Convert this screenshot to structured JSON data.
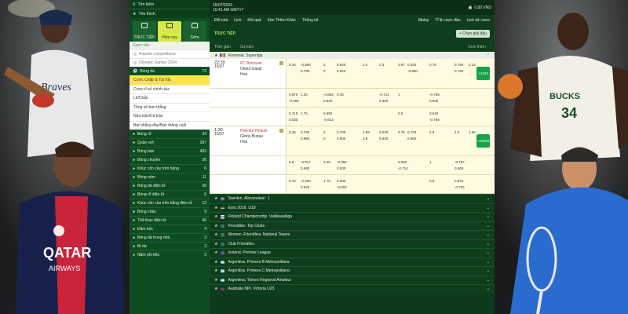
{
  "sidebar": {
    "search_label": "Tìm kiếm",
    "favorites_label": "Yêu thích",
    "tabs": [
      {
        "label": "TRỰC TIẾP",
        "active": false
      },
      {
        "label": "Hôm nay",
        "active": true
      },
      {
        "label": "Sớm",
        "active": false
      }
    ],
    "section_title": "Gạch sẵn",
    "suggestions": [
      "Popular competitions",
      "Olympic Games 2024"
    ],
    "football": {
      "label": "Bóng đá",
      "count": "72"
    },
    "bet_types": [
      "Cược Chấp & Tài Xỉu",
      "Cược tỉ số chính xác",
      "Lẻ/Chẵn",
      "Tổng số bàn thắng",
      "Nửa trận/Cả trận",
      "Bàn thắng đầu/Bàn thắng cuối"
    ],
    "sports": [
      {
        "label": "Bóng rổ",
        "count": "24"
      },
      {
        "label": "Quần vợt",
        "count": "287"
      },
      {
        "label": "Bóng bàn",
        "count": "409"
      },
      {
        "label": "Bóng chuyền",
        "count": "36"
      },
      {
        "label": "Khúc côn cầu trên băng",
        "count": "6"
      },
      {
        "label": "Bóng ném",
        "count": "11"
      },
      {
        "label": "Bóng đá điện tử",
        "count": "58"
      },
      {
        "label": "Bóng rổ điện tử",
        "count": "6"
      },
      {
        "label": "Khúc côn cầu trên băng điện tử",
        "count": "12"
      },
      {
        "label": "Bóng chày",
        "count": "9"
      },
      {
        "label": "Thể thao điện tử",
        "count": "46"
      },
      {
        "label": "Đấm bốc",
        "count": "4"
      },
      {
        "label": "Bóng đá trong nhà",
        "count": "3"
      },
      {
        "label": "Bi-da",
        "count": "3"
      },
      {
        "label": "Năm phi tiêu",
        "count": "3"
      }
    ]
  },
  "topbar": {
    "date": "15/07/2024",
    "time": "10:41 AM GMT+7",
    "balance": "0.00 VND"
  },
  "nav": {
    "items": [
      "Đổi nhà",
      "Lịch",
      "Kết quả",
      "Kèo Thêm Khảo",
      "Thống kê"
    ],
    "right": [
      "Malay",
      "Tỉ lệ cược đầu",
      "Lịch sử cược"
    ]
  },
  "section": {
    "live_label": "TRỰC TIẾP",
    "button_label": "Chọn giải đấu"
  },
  "columns": {
    "time": "Thời gian",
    "event": "Sự kiện",
    "more": "Xem thêm"
  },
  "league_main": "Romania. Superliga",
  "matches": [
    {
      "time": "22:30",
      "date": "15/07",
      "home": "FC Botosani",
      "away": "Otelul Galati",
      "draw": "Hoà",
      "more": "+1103",
      "rows": [
        [
          "0.25",
          "-0.990",
          "2",
          "0.830",
          "2.4",
          "2.3",
          "2.87",
          "0.630",
          "0.75",
          "0.780",
          "2.15",
          "4.1",
          "1.90"
        ],
        [
          "",
          "0.790",
          "0",
          "0.820",
          "",
          "",
          "",
          "-0.980",
          "",
          "0.790",
          "",
          "",
          ""
        ]
      ],
      "extra": [
        [
          "0.670",
          "1.25",
          "-0.862",
          "0.25",
          "-0.714",
          "1",
          "-0.769"
        ],
        [
          "-0.909",
          "",
          "0.620",
          "",
          "0.500",
          "",
          "0.500"
        ],
        [
          "0.718",
          "1.75",
          "0.650",
          "",
          "",
          "0.5",
          "0.540"
        ],
        [
          "0.530",
          "",
          "-0.813",
          "",
          "",
          "",
          "-0.758"
        ]
      ]
    },
    {
      "time": "1:30",
      "date": "16/07",
      "home": "Petrolul Ploiesti",
      "away": "Gloria Buzau",
      "draw": "Hoà",
      "more": "+10293",
      "rows": [
        [
          "0.25",
          "0.750",
          "2",
          "0.790",
          "2.09",
          "0.630",
          "0.75",
          "0.720",
          "2.8",
          "4.0",
          "1.95"
        ],
        [
          "",
          "0.980",
          "0",
          "0.950",
          "3.8",
          "0.630",
          "",
          "0.960",
          "",
          "",
          ""
        ]
      ],
      "extra": [
        [
          "0.5",
          "-0.917",
          "2.25",
          "-0.050",
          "",
          "0.500",
          "1",
          "-0.787"
        ],
        [
          "",
          "0.690",
          "",
          "0.630",
          "",
          "-0.714",
          "",
          "0.500"
        ],
        [
          "0.75",
          "-0.800",
          "1.75",
          "0.590",
          "",
          "",
          "0.5",
          "0.510"
        ],
        [
          "",
          "0.520",
          "",
          "-0.800",
          "",
          "",
          "",
          "-0.725"
        ]
      ]
    }
  ],
  "leagues": [
    {
      "name": "Sweden. Allsvenskan",
      "count": "1",
      "colors": [
        "#2a5db0",
        "#f4c430"
      ]
    },
    {
      "name": "Euro 2016. U19",
      "count": "",
      "colors": [
        "#1f3d8a",
        "#f4c430"
      ]
    },
    {
      "name": "Finland Championship. Veikkausliiga",
      "count": "",
      "colors": [
        "#ffffff",
        "#2a5db0"
      ]
    },
    {
      "name": "Friendlies. Top Clubs",
      "count": "",
      "colors": [
        "#3a8f3a",
        "#2a5db0"
      ]
    },
    {
      "name": "Women. Friendlies. National Teams",
      "count": "",
      "colors": [
        "#3a8f3a",
        "#2a5db0"
      ]
    },
    {
      "name": "Club Friendlies",
      "count": "",
      "colors": [
        "#3a8f3a",
        "#2a5db0"
      ]
    },
    {
      "name": "Iceland. Premier League",
      "count": "",
      "colors": [
        "#2a5db0",
        "#d23b3b"
      ]
    },
    {
      "name": "Argentina. Primera B Metropolitana",
      "count": "",
      "colors": [
        "#74acdf",
        "#ffffff"
      ]
    },
    {
      "name": "Argentina. Primera C Metropolitana",
      "count": "",
      "colors": [
        "#74acdf",
        "#ffffff"
      ]
    },
    {
      "name": "Argentina. Torneo Regional Amateur",
      "count": "",
      "colors": [
        "#74acdf",
        "#ffffff"
      ]
    },
    {
      "name": "Australia NPL Victoria U23",
      "count": "",
      "colors": [
        "#1f3d8a",
        "#d23b3b"
      ]
    }
  ]
}
